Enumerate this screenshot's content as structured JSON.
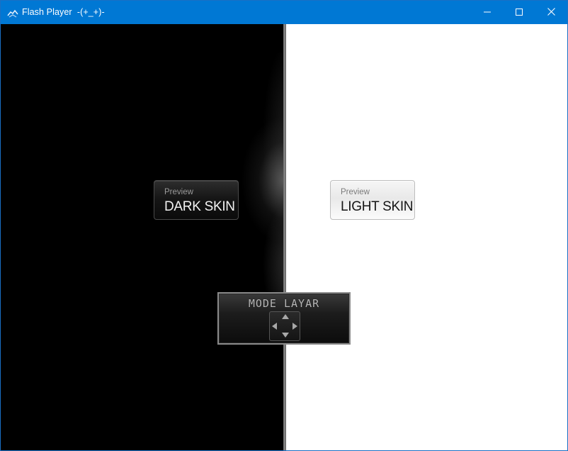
{
  "window": {
    "title": "Flash Player  -(+_+)-",
    "app_icon": "flash-player-icon",
    "titlebar_color": "#0078d4",
    "controls": {
      "minimize_icon": "minimize-icon",
      "maximize_icon": "maximize-icon",
      "close_icon": "close-icon"
    }
  },
  "skins": {
    "dark": {
      "small_label": "Preview",
      "big_label": "DARK SKIN",
      "background": "#000000"
    },
    "light": {
      "small_label": "Preview",
      "big_label": "LIGHT SKIN",
      "background": "#ffffff"
    }
  },
  "mode_panel": {
    "title": "MODE LAYAR",
    "icon": "directional-pad-icon",
    "arrows": [
      "up",
      "down",
      "left",
      "right"
    ]
  }
}
